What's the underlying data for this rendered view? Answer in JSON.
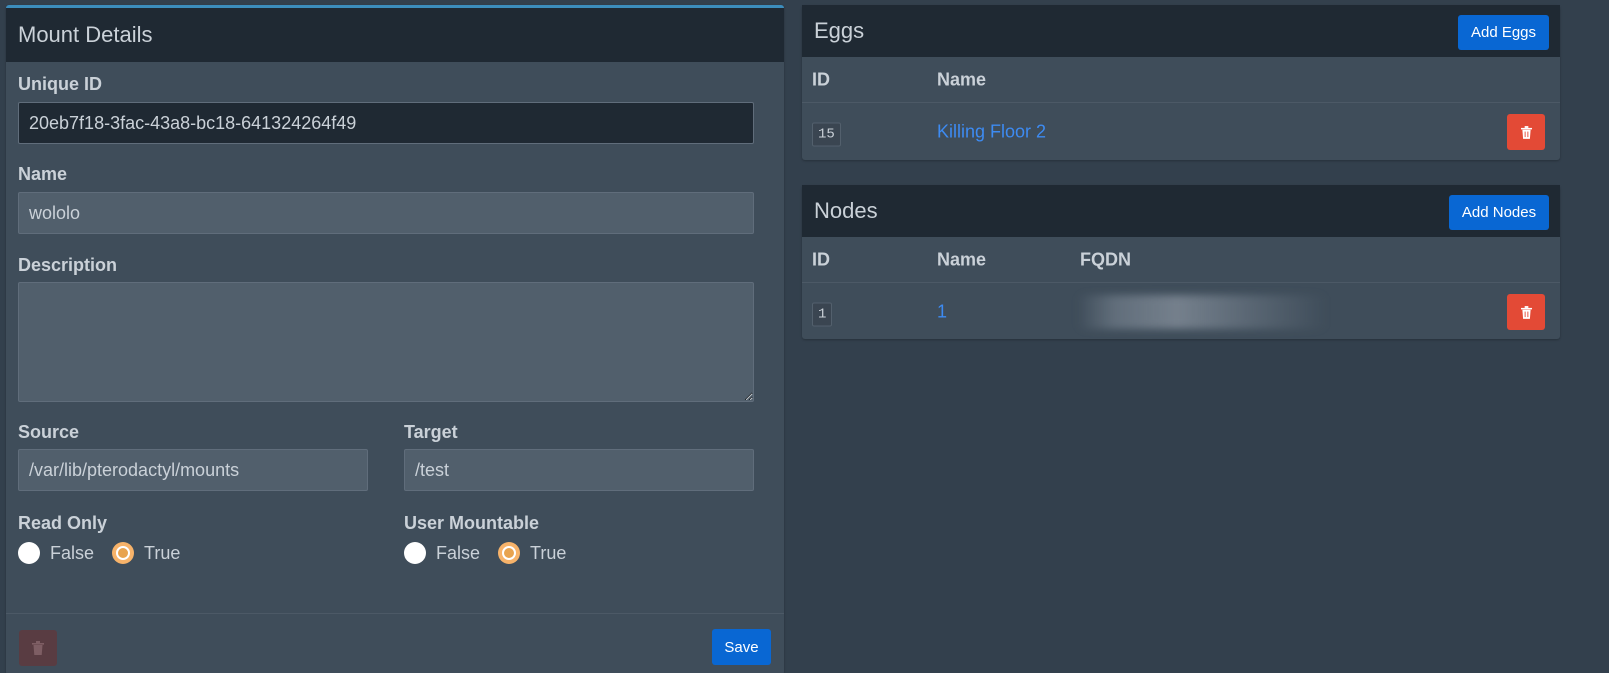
{
  "mount": {
    "title": "Mount Details",
    "unique_id_label": "Unique ID",
    "unique_id_value": "20eb7f18-3fac-43a8-bc18-641324264f49",
    "name_label": "Name",
    "name_value": "wololo",
    "description_label": "Description",
    "description_value": "",
    "source_label": "Source",
    "source_value": "/var/lib/pterodactyl/mounts",
    "target_label": "Target",
    "target_value": "/test",
    "read_only_label": "Read Only",
    "user_mountable_label": "User Mountable",
    "false_label": "False",
    "true_label": "True",
    "read_only_value": "True",
    "user_mountable_value": "True",
    "save_label": "Save"
  },
  "eggs": {
    "title": "Eggs",
    "add_label": "Add Eggs",
    "columns": [
      "ID",
      "Name"
    ],
    "rows": [
      {
        "id": "15",
        "name": "Killing Floor 2"
      }
    ]
  },
  "nodes": {
    "title": "Nodes",
    "add_label": "Add Nodes",
    "columns": [
      "ID",
      "Name",
      "FQDN"
    ],
    "rows": [
      {
        "id": "1",
        "name": "1",
        "fqdn": ""
      }
    ]
  },
  "colors": {
    "primary": "#0967d3",
    "danger": "#e34a36",
    "link": "#3d8bf2",
    "header_bg": "#1f2933",
    "page_bg": "#33404d"
  },
  "icons": {
    "delete": "trash-icon"
  }
}
